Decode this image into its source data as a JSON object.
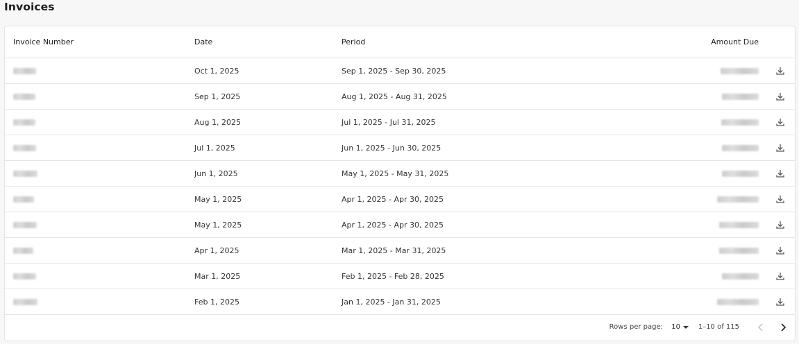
{
  "page": {
    "title": "Invoices"
  },
  "table": {
    "headers": {
      "invoice_number": "Invoice Number",
      "date": "Date",
      "period": "Period",
      "amount_due": "Amount Due"
    },
    "rows": [
      {
        "date": "Oct 1, 2025",
        "period": "Sep 1, 2025 - Sep 30, 2025"
      },
      {
        "date": "Sep 1, 2025",
        "period": "Aug 1, 2025 - Aug 31, 2025"
      },
      {
        "date": "Aug 1, 2025",
        "period": "Jul 1, 2025 - Jul 31, 2025"
      },
      {
        "date": "Jul 1, 2025",
        "period": "Jun 1, 2025 - Jun 30, 2025"
      },
      {
        "date": "Jun 1, 2025",
        "period": "May 1, 2025 - May 31, 2025"
      },
      {
        "date": "May 1, 2025",
        "period": "Apr 1, 2025 - Apr 30, 2025"
      },
      {
        "date": "May 1, 2025",
        "period": "Apr 1, 2025 - Apr 30, 2025"
      },
      {
        "date": "Apr 1, 2025",
        "period": "Mar 1, 2025 - Mar 31, 2025"
      },
      {
        "date": "Mar 1, 2025",
        "period": "Feb 1, 2025 - Feb 28, 2025"
      },
      {
        "date": "Feb 1, 2025",
        "period": "Jan 1, 2025 - Jan 31, 2025"
      }
    ],
    "download_icon": "download-icon"
  },
  "pagination": {
    "rows_per_page_label": "Rows per page:",
    "rows_per_page_value": "10",
    "range_text": "1–10 of 115",
    "prev_icon": "chevron-left-icon",
    "next_icon": "chevron-right-icon"
  },
  "colors": {
    "border": "#e6e6e6",
    "background": "#f7f7f7",
    "text": "#333333"
  }
}
